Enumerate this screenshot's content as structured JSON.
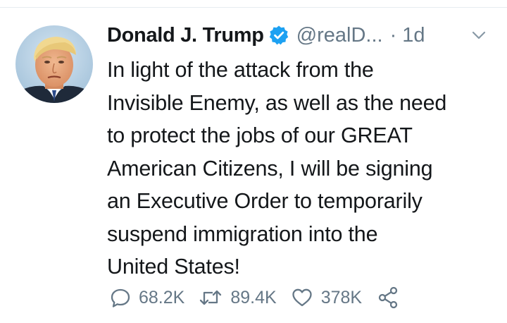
{
  "user": {
    "display_name": "Donald J. Trump",
    "handle": "@realD...",
    "separator": "·",
    "time": "1d",
    "verified": true
  },
  "tweet": {
    "lines": [
      "In light of the attack from the",
      "Invisible Enemy, as well as the need",
      "to protect the jobs of our GREAT",
      "American Citizens, I will be signing",
      "an Executive Order to temporarily",
      "suspend immigration into the",
      "United States!"
    ]
  },
  "actions": {
    "replies": "68.2K",
    "retweets": "89.4K",
    "likes": "378K"
  },
  "icons": {
    "verified": "verified-badge-icon",
    "caret": "chevron-down-icon",
    "reply": "reply-icon",
    "retweet": "retweet-icon",
    "like": "heart-icon",
    "share": "share-icon"
  },
  "colors": {
    "text": "#14171a",
    "secondary": "#657786",
    "verified": "#1da1f2",
    "divider": "#e6ecf0"
  }
}
